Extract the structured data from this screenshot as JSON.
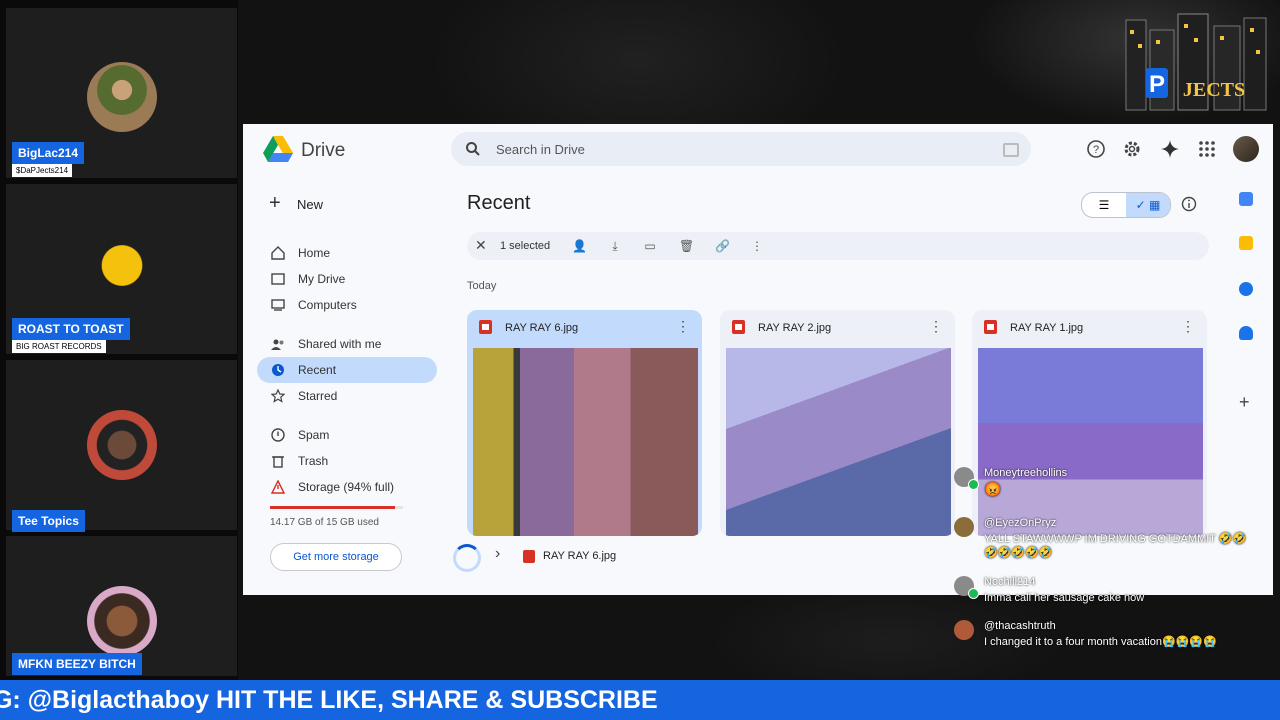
{
  "guests": [
    {
      "name": "BigLac214",
      "subtitle": "$DaPJects214"
    },
    {
      "name": "ROAST TO TOAST",
      "subtitle": "BIG ROAST RECORDS"
    },
    {
      "name": "Tee Topics",
      "subtitle": ""
    },
    {
      "name": "MFKN BEEZY BITCH",
      "subtitle": ""
    }
  ],
  "drive": {
    "title": "Drive",
    "search_placeholder": "Search in Drive",
    "new_label": "New",
    "nav": [
      {
        "label": "Home",
        "icon": "home-icon"
      },
      {
        "label": "My Drive",
        "icon": "my-drive-icon"
      },
      {
        "label": "Computers",
        "icon": "computer-icon"
      },
      {
        "label": "Shared with me",
        "icon": "shared-icon"
      },
      {
        "label": "Recent",
        "icon": "clock-icon"
      },
      {
        "label": "Starred",
        "icon": "star-icon"
      },
      {
        "label": "Spam",
        "icon": "spam-icon"
      },
      {
        "label": "Trash",
        "icon": "trash-icon"
      },
      {
        "label": "Storage (94% full)",
        "icon": "warning-icon"
      }
    ],
    "storage_fraction": 0.94,
    "storage_text": "14.17 GB of 15 GB used",
    "get_storage_label": "Get more storage",
    "page_title": "Recent",
    "selection_text": "1 selected",
    "section_label": "Today",
    "files": [
      {
        "name": "RAY RAY 6.jpg",
        "selected": true
      },
      {
        "name": "RAY RAY 2.jpg",
        "selected": false
      },
      {
        "name": "RAY RAY 1.jpg",
        "selected": false
      }
    ],
    "status_file": "RAY RAY 6.jpg"
  },
  "chat": [
    {
      "user": "Moneytreehollins",
      "text": "",
      "avatar_color": "#8a8a8a"
    },
    {
      "user": "@EyezOnPryz",
      "text": "YALL STAWWWWP IM DRIVING GOTDAMMIT 🤣🤣🤣🤣🤣🤣🤣",
      "avatar_color": "#8a6d3b"
    },
    {
      "user": "Nochill214",
      "text": "Imma call her sausage cake now",
      "avatar_color": "#8a8a8a"
    },
    {
      "user": "@thacashtruth",
      "text": "I changed it to a four month vacation😭😭😭😭",
      "avatar_color": "#b05a3a"
    }
  ],
  "ticker_text": "IG: @Biglacthaboy HIT THE LIKE, SHARE & SUBSCRIBE"
}
